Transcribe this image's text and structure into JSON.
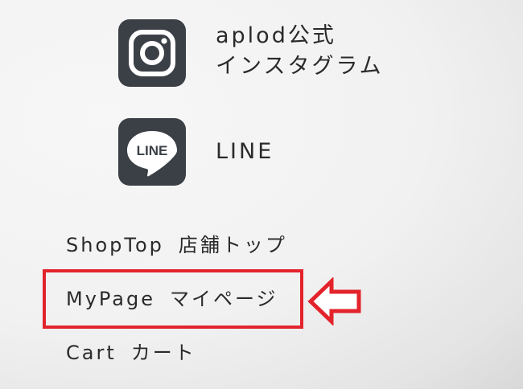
{
  "social": {
    "instagram": {
      "icon": "instagram-icon",
      "label_line1": "aplod公式",
      "label_line2": "インスタグラム"
    },
    "line": {
      "icon": "line-icon",
      "icon_text": "LINE",
      "label": "LINE"
    }
  },
  "nav": {
    "shoptop": {
      "en": "ShopTop",
      "jp": "店舗トップ"
    },
    "mypage": {
      "en": "MyPage",
      "jp": "マイページ"
    },
    "cart": {
      "en": "Cart",
      "jp": "カート"
    }
  },
  "annotation": {
    "highlight_color": "#e3232b",
    "arrow_direction": "left"
  }
}
